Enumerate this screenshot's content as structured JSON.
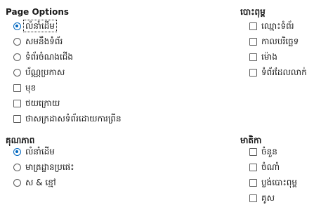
{
  "page_options": {
    "title": "Page Options",
    "items": [
      {
        "type": "radio",
        "label": "លំនាំដើម",
        "checked": true,
        "focused": true
      },
      {
        "type": "radio",
        "label": "សមនឹងទំព័រ",
        "checked": false
      },
      {
        "type": "radio",
        "label": "ទំព័រចំណងជើង",
        "checked": false
      },
      {
        "type": "radio",
        "label": "ប័ណ្ណប្រកាស",
        "checked": false
      },
      {
        "type": "checkbox",
        "label": "មុខ",
        "checked": false
      },
      {
        "type": "checkbox",
        "label": "ថយក្រោយ",
        "checked": false
      },
      {
        "type": "checkbox",
        "label": "ថាសក្រដាសទំព័រដោយការព្រីន",
        "checked": false
      }
    ]
  },
  "include": {
    "title": "បោះពុម្ព",
    "items": [
      {
        "label": "ឈ្មោះទំព័រ",
        "checked": false
      },
      {
        "label": "កាលបរិច្ឆេទ",
        "checked": false
      },
      {
        "label": "ម៉ោង",
        "checked": false
      },
      {
        "label": "ទំព័រដែលលាក់",
        "checked": false
      }
    ]
  },
  "quality": {
    "title": "គុណភាព",
    "items": [
      {
        "label": "លំនាំដើម",
        "checked": true
      },
      {
        "label": "មាត្រដ្ឋានប្រផេះ",
        "checked": false
      },
      {
        "label": "ស & ខ្មៅ",
        "checked": false
      }
    ]
  },
  "contents": {
    "title": "មាតិកា",
    "items": [
      {
        "label": "ចំនួន",
        "checked": false
      },
      {
        "label": "ចំណាំ",
        "checked": false
      },
      {
        "label": "ប្លង់បោះពុម្ព",
        "checked": false
      },
      {
        "label": "គូស",
        "checked": false
      }
    ]
  }
}
